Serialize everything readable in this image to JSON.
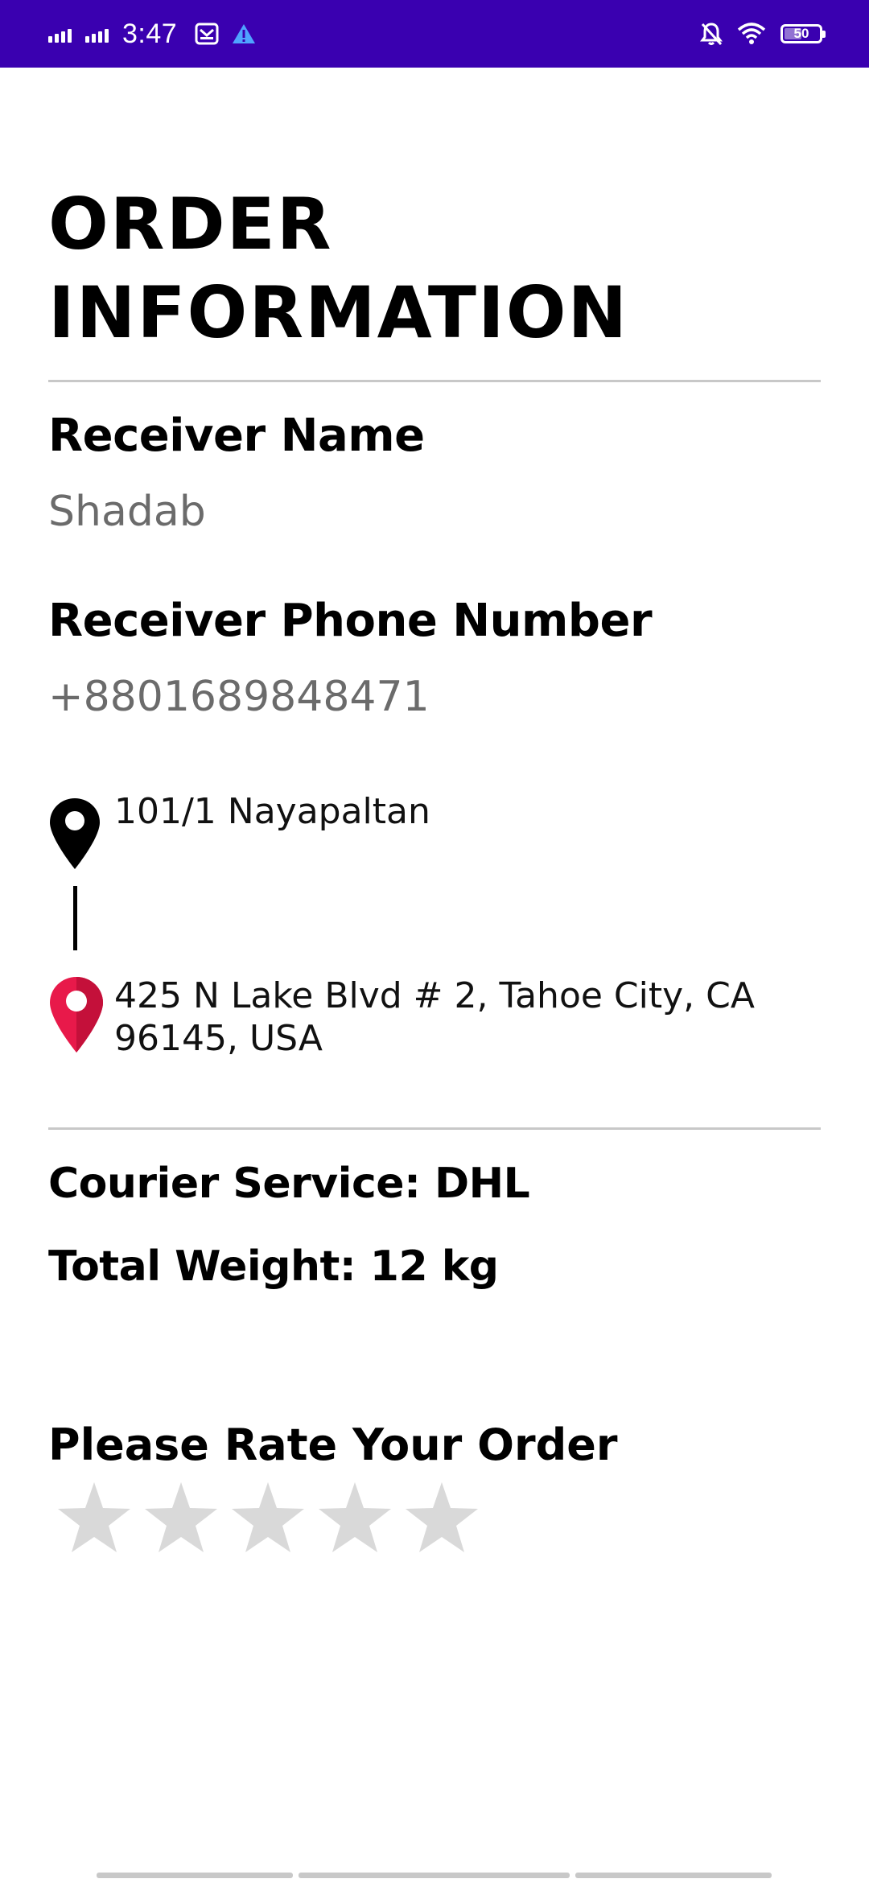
{
  "status_bar": {
    "time": "3:47",
    "battery_level": "50",
    "icons": [
      "signal-icon",
      "signal-icon",
      "mail-icon",
      "warning-icon",
      "bell-off-icon",
      "wifi-icon",
      "battery-icon"
    ],
    "background": "#3a00b0"
  },
  "order": {
    "title_line1": "ORDER",
    "title_line2": "INFORMATION",
    "receiver_name_label": "Receiver Name",
    "receiver_name": "Shadab",
    "receiver_phone_label": "Receiver Phone Number",
    "receiver_phone": "+8801689848471",
    "pickup_address": "101/1 Nayapaltan",
    "destination_address": "425 N Lake Blvd # 2, Tahoe City, CA 96145, USA",
    "courier_service": "Courier Service: DHL",
    "total_weight": "Total Weight: 12 kg"
  },
  "rating": {
    "heading": "Please Rate Your Order",
    "max_stars": 5,
    "selected_stars": 0,
    "star_color": "#d9d9d9"
  },
  "colors": {
    "pickup_pin": "#000000",
    "destination_pin": "#e8194a",
    "divider": "#c8c8c8",
    "value_text": "#6b6b6b"
  }
}
